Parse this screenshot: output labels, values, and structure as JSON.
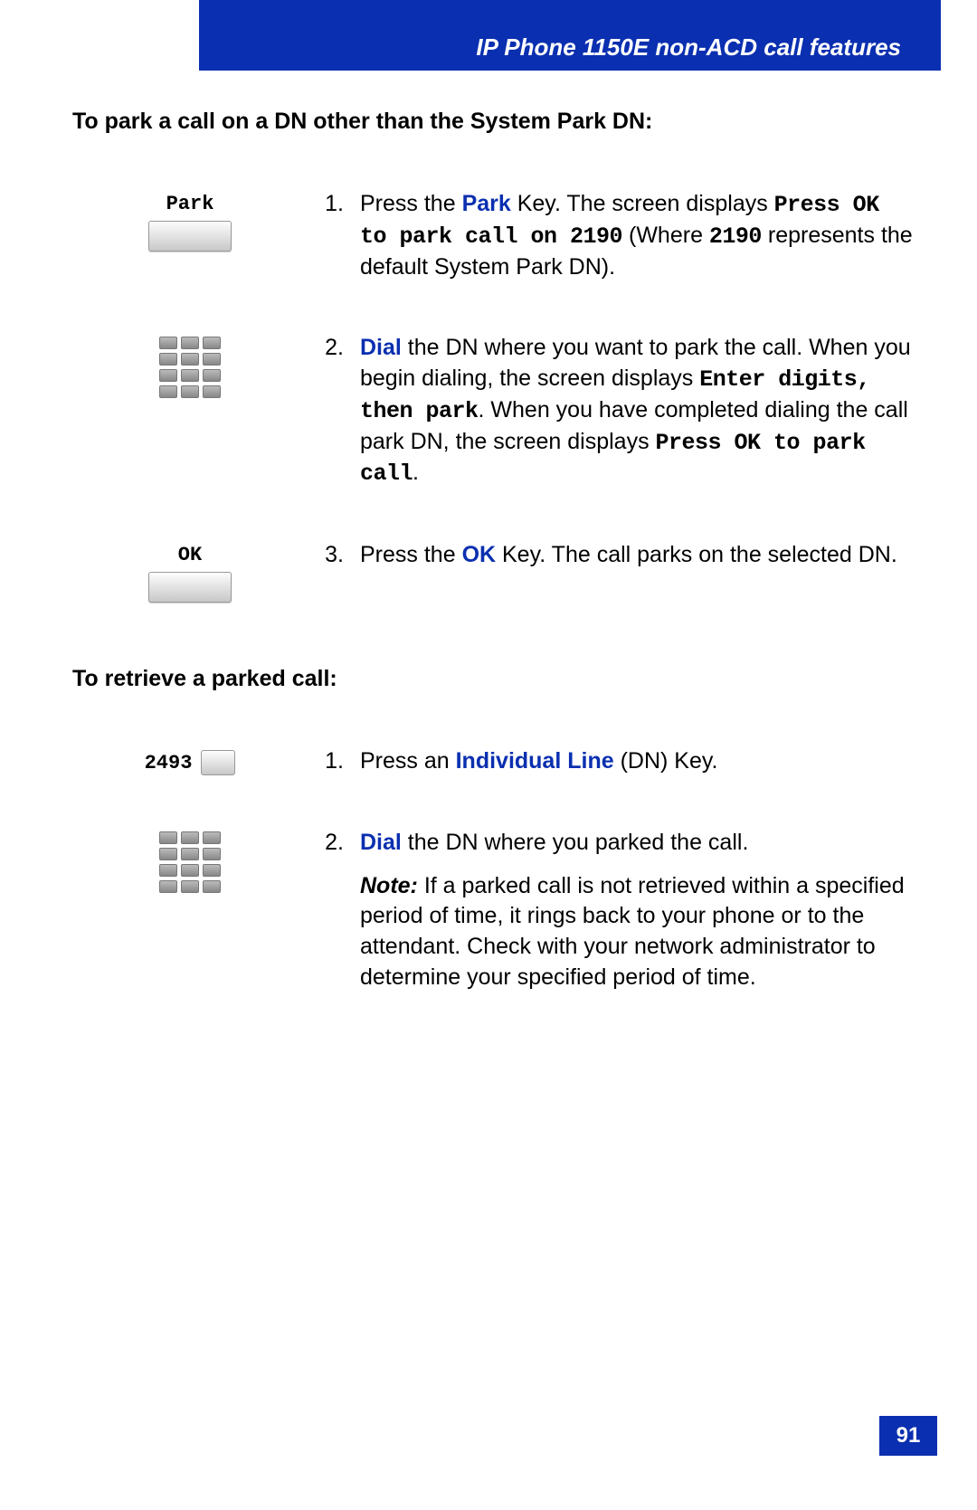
{
  "header": {
    "title": "IP Phone 1150E non-ACD call features"
  },
  "section1": {
    "title": "To park a call on a DN other than the System Park DN:",
    "steps": [
      {
        "num": "1.",
        "icon": "softkey",
        "iconLabel": "Park",
        "pre": "Press the ",
        "kw": "Park",
        "post1": " Key. The screen displays ",
        "mono1": "Press OK to park call on 2190",
        "post2": " (Where ",
        "mono2": "2190",
        "post3": " represents the default System Park DN)."
      },
      {
        "num": "2.",
        "icon": "keypad",
        "kw": "Dial",
        "post1": " the DN where you want to park the call. When you begin dialing, the screen displays ",
        "mono1": "Enter digits, then park",
        "post2": ". When you have completed dialing the call park DN, the screen displays ",
        "mono2": "Press OK to park call",
        "post3": "."
      },
      {
        "num": "3.",
        "icon": "softkey",
        "iconLabel": "OK",
        "pre": "Press the ",
        "kw": "OK",
        "post1": " Key. The call parks on the selected DN."
      }
    ]
  },
  "section2": {
    "title": "To retrieve a parked call:",
    "steps": [
      {
        "num": "1.",
        "icon": "linekey",
        "iconLabel": "2493",
        "pre": "Press an ",
        "kw": "Individual Line",
        "post1": " (DN) Key."
      },
      {
        "num": "2.",
        "icon": "keypad",
        "kw": "Dial",
        "post1": " the DN where you parked the call.",
        "noteLabel": "Note:",
        "noteBody": " If a parked call is not retrieved within a specified period of time, it rings back to your phone or to the attendant. Check with your network administrator to determine your specified period of time."
      }
    ]
  },
  "pageNumber": "91"
}
